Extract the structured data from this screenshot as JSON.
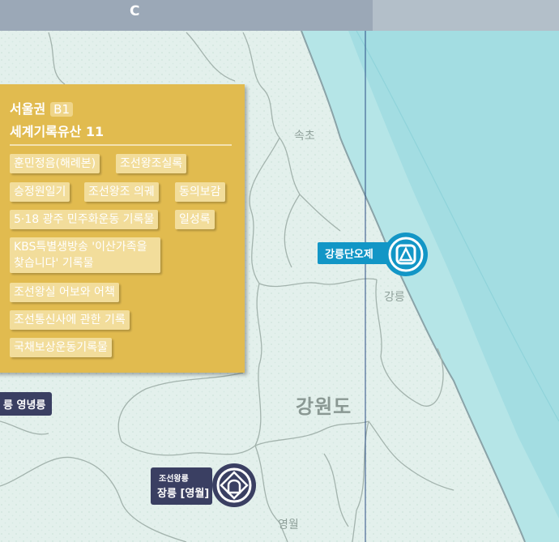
{
  "header": {
    "column_label": "C"
  },
  "places": {
    "sokcho": "속초",
    "gangneung": "강릉",
    "yeongwol": "영월"
  },
  "region": {
    "province": "강원도"
  },
  "panel": {
    "region": "서울권",
    "grid": "B1",
    "heading": "세계기록유산 11",
    "items": [
      "훈민정음(해례본)",
      "조선왕조실록",
      "승정원일기",
      "조선왕조 의궤",
      "동의보감",
      "5·18 광주 민주화운동 기록물",
      "일성록",
      "KBS특별생방송 '이산가족을 찾습니다' 기록물",
      "조선왕실 어보와 어책",
      "조선통신사에 관한 기록",
      "국채보상운동기록물"
    ]
  },
  "markers": {
    "gangneung_dano": "강릉단오제",
    "jangneung_category": "조선왕릉",
    "jangneung_name": "장릉 [영월]",
    "yeongnyeong": "릉 영녕릉"
  },
  "colors": {
    "land": "#e3f0ec",
    "sea": "#9fdbe1",
    "panel": "#e1bb4f",
    "intangible_marker": "#1296c6",
    "cultural_marker": "#3a3f62"
  },
  "icons": {
    "intangible_heritage": "unesco-intangible-heritage-icon",
    "world_heritage": "unesco-world-heritage-icon"
  }
}
